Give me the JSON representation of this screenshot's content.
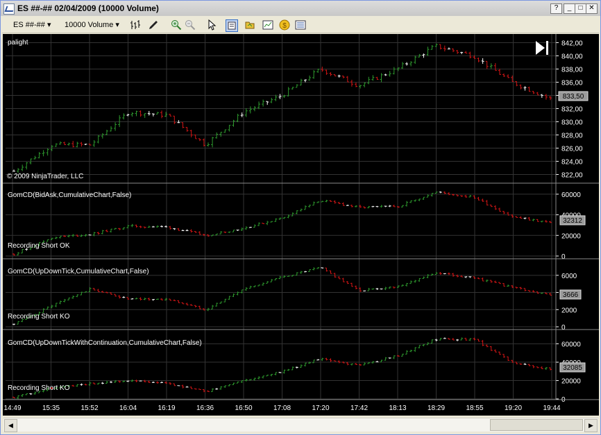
{
  "window": {
    "title": "ES ##-##  02/04/2009 (10000 Volume)",
    "buttons": {
      "help": "?",
      "minimize": "_",
      "maximize": "□",
      "close": "✕"
    }
  },
  "toolbar": {
    "instrument": "ES ##-##",
    "period": "10000 Volume"
  },
  "icons": [
    "chart-window-icon",
    "bar-type-icon",
    "drawing-tool-icon",
    "zoom-in-icon",
    "zoom-out-icon",
    "pointer-icon",
    "data-box-icon",
    "strategy-icon",
    "performance-icon",
    "money-icon",
    "properties-icon",
    "end-of-chart-icon",
    "scroll-left-icon",
    "scroll-right-icon"
  ],
  "colors": {
    "up_bar": "#2e9a2e",
    "down_bar": "#d41616",
    "neutral_bar": "#ffffff",
    "background": "#000000",
    "grid": "#333333",
    "panel_border": "#8a8a8a"
  },
  "panels": [
    {
      "label": "palight",
      "footer": "© 2009 NinjaTrader, LLC",
      "last_value": "833,50",
      "axis": [
        "842,00",
        "840,00",
        "838,00",
        "836,00",
        "834,00",
        "832,00",
        "830,00",
        "828,00",
        "826,00",
        "824,00",
        "822,00"
      ]
    },
    {
      "label": "GomCD(BidAsk,CumulativeChart,False)",
      "status": "Recording Short OK",
      "last_value": "32312",
      "axis": [
        "60000",
        "40000",
        "20000",
        "0"
      ]
    },
    {
      "label": "GomCD(UpDownTick,CumulativeChart,False)",
      "status": "Recording Short KO",
      "last_value": "3666",
      "axis": [
        "6000",
        "4000",
        "2000",
        "0"
      ]
    },
    {
      "label": "GomCD(UpDownTickWithContinuation,CumulativeChart,False)",
      "status": "Recording Short KO",
      "last_value": "32085",
      "axis": [
        "60000",
        "40000",
        "20000",
        "0"
      ]
    }
  ],
  "time_axis": [
    "14:49",
    "15:35",
    "15:52",
    "16:04",
    "16:19",
    "16:36",
    "16:50",
    "17:08",
    "17:20",
    "17:42",
    "18:13",
    "18:29",
    "18:55",
    "19:20",
    "19:44"
  ],
  "chart_data": [
    {
      "type": "ohlc",
      "title": "palight",
      "ylim": [
        821,
        843
      ],
      "x": [
        "14:49",
        "15:35",
        "15:52",
        "16:04",
        "16:19",
        "16:36",
        "16:50",
        "17:08",
        "17:20",
        "17:42",
        "18:13",
        "18:29",
        "18:55",
        "19:20",
        "19:44"
      ],
      "series": [
        {
          "values": [
            822.5,
            826.5,
            826.5,
            831.5,
            831.0,
            826.5,
            831.5,
            834.0,
            838.0,
            835.5,
            838.0,
            841.5,
            840.0,
            836.0,
            833.5
          ]
        }
      ]
    },
    {
      "type": "ohlc",
      "title": "GomCD(BidAsk,CumulativeChart,False)",
      "ylim": [
        0,
        66000
      ],
      "x": [
        "14:49",
        "15:35",
        "15:52",
        "16:04",
        "16:19",
        "16:36",
        "16:50",
        "17:08",
        "17:20",
        "17:42",
        "18:13",
        "18:29",
        "18:55",
        "19:20",
        "19:44"
      ],
      "series": [
        {
          "values": [
            2000,
            18000,
            21000,
            29000,
            28000,
            20000,
            27000,
            37000,
            54000,
            47000,
            48000,
            62000,
            57000,
            38000,
            32312
          ]
        }
      ]
    },
    {
      "type": "ohlc",
      "title": "GomCD(UpDownTick,CumulativeChart,False)",
      "ylim": [
        0,
        7200
      ],
      "x": [
        "14:49",
        "15:35",
        "15:52",
        "16:04",
        "16:19",
        "16:36",
        "16:50",
        "17:08",
        "17:20",
        "17:42",
        "18:13",
        "18:29",
        "18:55",
        "19:20",
        "19:44"
      ],
      "series": [
        {
          "values": [
            300,
            2500,
            4400,
            3200,
            3200,
            2000,
            4400,
            5800,
            6900,
            4200,
            4700,
            6300,
            5700,
            4600,
            3666
          ]
        }
      ]
    },
    {
      "type": "ohlc",
      "title": "GomCD(UpDownTickWithContinuation,CumulativeChart,False)",
      "ylim": [
        0,
        68000
      ],
      "x": [
        "14:49",
        "15:35",
        "15:52",
        "16:04",
        "16:19",
        "16:36",
        "16:50",
        "17:08",
        "17:20",
        "17:42",
        "18:13",
        "18:29",
        "18:55",
        "19:20",
        "19:44"
      ],
      "series": [
        {
          "values": [
            2000,
            12000,
            17000,
            20000,
            17000,
            8000,
            20000,
            30000,
            44000,
            36000,
            47000,
            65000,
            65000,
            40000,
            32085
          ]
        }
      ]
    }
  ]
}
